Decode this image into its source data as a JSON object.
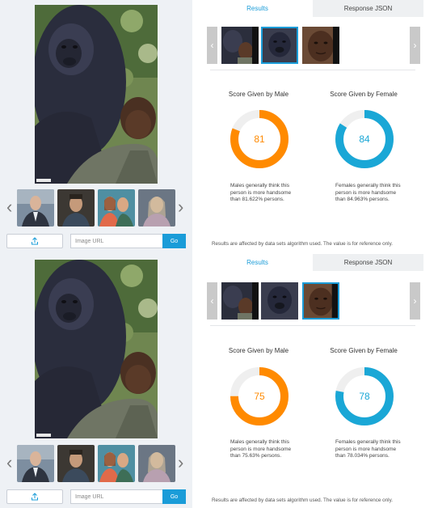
{
  "panels": [
    {
      "thumbnail_arrows": {
        "left": "‹",
        "right": "›"
      },
      "upload_icon": "upload-icon",
      "url_placeholder": "Image URL",
      "go_label": "Go",
      "tabs": {
        "results": "Results",
        "response_json": "Response JSON"
      },
      "carousel_arrows": {
        "left": "‹",
        "right": "›"
      },
      "male": {
        "title": "Score Given by Male",
        "score": 81,
        "value_text": "81",
        "desc": "Males generally think this person is more handsome than 81.622% persons.",
        "color": "#ff8a00"
      },
      "female": {
        "title": "Score Given by Female",
        "score": 84,
        "value_text": "84",
        "desc": "Females generally think this person is more handsome than 84.963% persons.",
        "color": "#1aa7d6"
      },
      "footnote": "Results are affected by data sets algorithm used. The value is for reference only."
    },
    {
      "thumbnail_arrows": {
        "left": "‹",
        "right": "›"
      },
      "upload_icon": "upload-icon",
      "url_placeholder": "Image URL",
      "go_label": "Go",
      "tabs": {
        "results": "Results",
        "response_json": "Response JSON"
      },
      "carousel_arrows": {
        "left": "‹",
        "right": "›"
      },
      "male": {
        "title": "Score Given by Male",
        "score": 75,
        "value_text": "75",
        "desc": "Males generally think this person is more handsome than 75.63% persons.",
        "color": "#ff8a00"
      },
      "female": {
        "title": "Score Given by Female",
        "score": 78,
        "value_text": "78",
        "desc": "Females generally think this person is more handsome than 78.034% persons.",
        "color": "#1aa7d6"
      },
      "footnote": "Results are affected by data sets algorithm used. The value is for reference only."
    }
  ],
  "colors": {
    "accent": "#1a9cd8",
    "male": "#ff8a00",
    "female": "#1aa7d6",
    "track": "#efefef"
  }
}
